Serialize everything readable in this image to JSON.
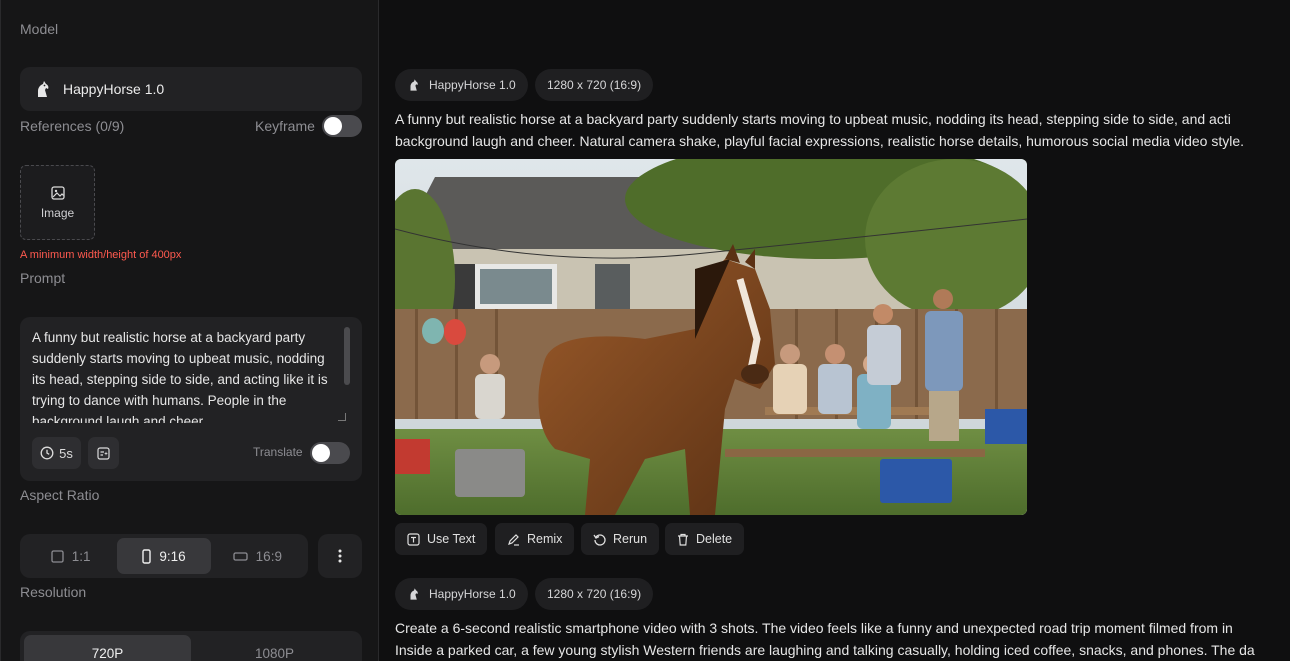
{
  "sidebar": {
    "model_label": "Model",
    "model_name": "HappyHorse 1.0",
    "references_label": "References (0/9)",
    "keyframe_label": "Keyframe",
    "image_button": "Image",
    "image_hint": "A minimum width/height of 400px",
    "prompt_label": "Prompt",
    "prompt_text": "A funny but realistic horse at a backyard party suddenly starts moving to upbeat music, nodding its head, stepping side to side, and acting like it is trying to dance with humans. People in the background laugh and cheer.",
    "duration_chip": "5s",
    "translate_label": "Translate",
    "aspect_label": "Aspect Ratio",
    "aspect_options": [
      "1:1",
      "9:16",
      "16:9"
    ],
    "aspect_selected": "9:16",
    "resolution_label": "Resolution",
    "resolution_options": [
      "720P",
      "1080P"
    ],
    "resolution_selected": "720P"
  },
  "feed": [
    {
      "model_tag": "HappyHorse 1.0",
      "size_tag": "1280 x 720 (16:9)",
      "prompt_line1": "A funny but realistic horse at a backyard party suddenly starts moving to upbeat music, nodding its head, stepping side to side, and acti",
      "prompt_line2": "background laugh and cheer. Natural camera shake, playful facial expressions, realistic horse details, humorous social media video style.",
      "actions": [
        "Use Text",
        "Remix",
        "Rerun",
        "Delete"
      ]
    },
    {
      "model_tag": "HappyHorse 1.0",
      "size_tag": "1280 x 720 (16:9)",
      "prompt_line1": "Create a 6-second realistic smartphone video with 3 shots. The video feels like a funny and unexpected road trip moment filmed from in",
      "prompt_line2": "Inside a parked car, a few young stylish Western friends are laughing and talking casually, holding iced coffee, snacks, and phones. The da"
    }
  ],
  "icons": {
    "model": "horse-logo-icon",
    "image": "image-icon",
    "clock": "clock-icon",
    "enhance": "prompt-enhance-icon",
    "more": "more-vertical-icon",
    "use_text": "text-icon",
    "remix": "remix-icon",
    "rerun": "rerun-icon",
    "delete": "trash-icon"
  }
}
